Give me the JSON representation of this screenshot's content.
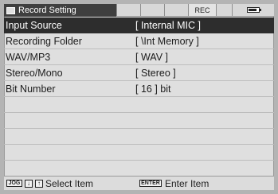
{
  "header": {
    "title": "Record Setting",
    "rec_indicator": "REC"
  },
  "settings": [
    {
      "label": "Input Source",
      "value": "[ Internal MIC ]"
    },
    {
      "label": "Recording Folder",
      "value": "[ \\Int Memory ]"
    },
    {
      "label": "WAV/MP3",
      "value": "[ WAV ]"
    },
    {
      "label": "Stereo/Mono",
      "value": "[ Stereo ]"
    },
    {
      "label": "Bit Number",
      "value": "[ 16 ] bit"
    }
  ],
  "footer": {
    "jog_key": "JOG",
    "down_key": "↓",
    "up_key": "↑",
    "select_text": "Select Item",
    "enter_key": "ENTER",
    "enter_text": "Enter Item"
  },
  "icons": {
    "title_icon": "screen-icon",
    "battery": "battery-icon"
  }
}
